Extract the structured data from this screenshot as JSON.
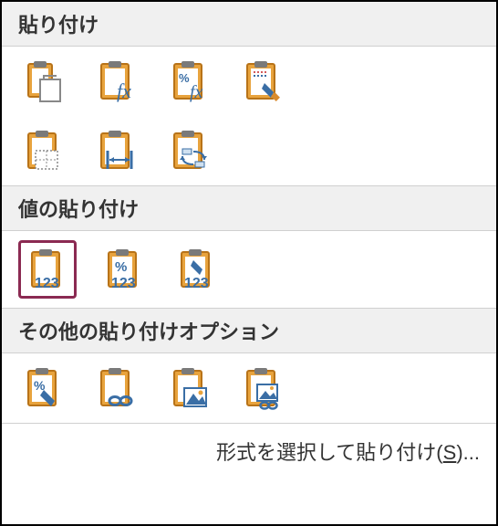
{
  "sections": {
    "paste": {
      "title": "貼り付け"
    },
    "values": {
      "title": "値の貼り付け"
    },
    "other": {
      "title": "その他の貼り付けオプション"
    }
  },
  "footer": {
    "prefix": "形式を選択して貼り付け(",
    "key": "S",
    "suffix": ")..."
  }
}
